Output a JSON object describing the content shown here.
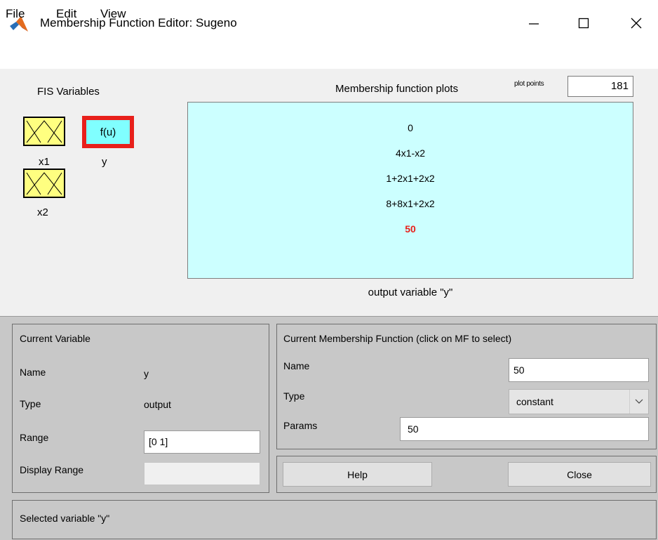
{
  "window": {
    "title": "Membership Function Editor: Sugeno",
    "icon": "matlab-logo-icon",
    "controls": [
      "minimize-icon",
      "maximize-icon",
      "close-icon"
    ]
  },
  "menu": {
    "file": "File",
    "edit": "Edit",
    "view": "View"
  },
  "fis_variables": {
    "label": "FIS Variables",
    "inputs": [
      {
        "name": "x1",
        "icon": "input-mf-icon"
      },
      {
        "name": "x2",
        "icon": "input-mf-icon"
      }
    ],
    "output": {
      "name": "y",
      "icon_text": "f(u)",
      "selected": true
    }
  },
  "plot": {
    "title": "Membership function plots",
    "plot_points_label": "plot points",
    "plot_points_value": "181",
    "functions": [
      "0",
      "4x1-x2",
      "1+2x1+2x2",
      "8+8x1+2x2",
      "50"
    ],
    "selected_function": "50",
    "selected_color": "#e8201b",
    "caption": "output variable \"y\""
  },
  "current_variable": {
    "title": "Current Variable",
    "name_label": "Name",
    "name_value": "y",
    "type_label": "Type",
    "type_value": "output",
    "range_label": "Range",
    "range_value": "[0 1]",
    "display_range_label": "Display Range",
    "display_range_value": ""
  },
  "current_mf": {
    "title": "Current Membership Function (click on MF to select)",
    "name_label": "Name",
    "name_value": "50",
    "type_label": "Type",
    "type_value": "constant",
    "params_label": "Params",
    "params_value": "50"
  },
  "buttons": {
    "help": "Help",
    "close": "Close"
  },
  "status": {
    "text": "Selected variable \"y\""
  },
  "colors": {
    "input_icon_bg": "#ffff80",
    "output_icon_bg": "#80ffff",
    "plot_bg": "#ccffff",
    "lower_panel_bg": "#c8c8c8"
  }
}
